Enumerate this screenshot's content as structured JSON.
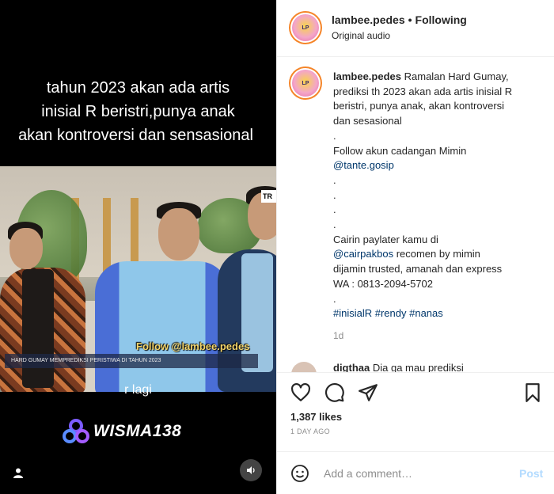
{
  "video": {
    "caption_lines": [
      "tahun 2023 akan ada artis",
      "inisial R beristri,punya anak",
      "akan kontroversi dan sensasional"
    ],
    "follow_watermark": "Follow @lambee.pedes",
    "ticker_text": "HARD GUMAY MEMPREDIKSI PERISTIWA DI TAHUN 2023",
    "subtitle": "r lagi",
    "brand_name": "WISMA138",
    "tv_logo": "TR"
  },
  "header": {
    "username": "lambee.pedes",
    "separator": "•",
    "follow_status": "Following",
    "audio": "Original audio"
  },
  "caption": {
    "username": "lambee.pedes",
    "lines": [
      "Ramalan Hard Gumay,",
      "prediksi th 2023 akan ada artis inisial R",
      "beristri, punya anak, akan kontroversi",
      "dan sesasional",
      ".",
      "Follow akun cadangan Mimin",
      "@tante.gosip",
      ".",
      ".",
      ".",
      ".",
      "Cairin paylater kamu di",
      "@cairpakbos recomen by mimin",
      "dijamin trusted, amanah dan express",
      "WA : 0813-2094-5702",
      ".",
      "#inisialR #rendy #nanas"
    ],
    "time": "1d"
  },
  "next_comment": {
    "username": "digthaa",
    "text": "Dia ga mau prediksi"
  },
  "actions": {
    "likes": "1,387 likes",
    "date": "1 DAY AGO"
  },
  "comment_input": {
    "placeholder": "Add a comment…",
    "post_label": "Post"
  },
  "colors": {
    "link": "#00376b",
    "post_disabled": "#b3dbff",
    "muted": "#8e8e8e"
  }
}
